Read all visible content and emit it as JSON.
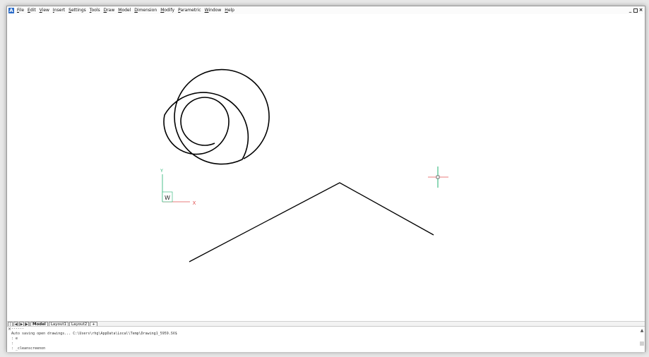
{
  "app": {
    "icon_letter": "A"
  },
  "menu": {
    "items": [
      {
        "label": "File"
      },
      {
        "label": "Edit"
      },
      {
        "label": "View"
      },
      {
        "label": "Insert"
      },
      {
        "label": "Settings"
      },
      {
        "label": "Tools"
      },
      {
        "label": "Draw"
      },
      {
        "label": "Model"
      },
      {
        "label": "Dimension"
      },
      {
        "label": "Modify"
      },
      {
        "label": "Parametric"
      },
      {
        "label": "Window"
      },
      {
        "label": "Help"
      }
    ]
  },
  "window_controls": {
    "minimize": "_",
    "close": "×"
  },
  "canvas": {
    "ucs_label": "W",
    "ucs_x_label": "X",
    "ucs_y_label": "Y",
    "colors": {
      "drawing": "#000000",
      "x_axis": "#e05050",
      "y_axis": "#20b070",
      "background": "#ffffff"
    }
  },
  "tabs": {
    "nav": [
      "|◀",
      "◀",
      "▶",
      "▶|"
    ],
    "items": [
      {
        "label": "Model",
        "active": true
      },
      {
        "label": "Layout1",
        "active": false
      },
      {
        "label": "Layout2",
        "active": false
      },
      {
        "label": "+",
        "active": false
      }
    ]
  },
  "command": {
    "close_glyph": "×",
    "lines": [
      "------",
      "Auto saving open drawings... C:\\Users\\rhg\\AppData\\Local\\Temp\\Drawing1_5959.SV$",
      ": e",
      ":",
      ": _cleanscreenon"
    ]
  }
}
